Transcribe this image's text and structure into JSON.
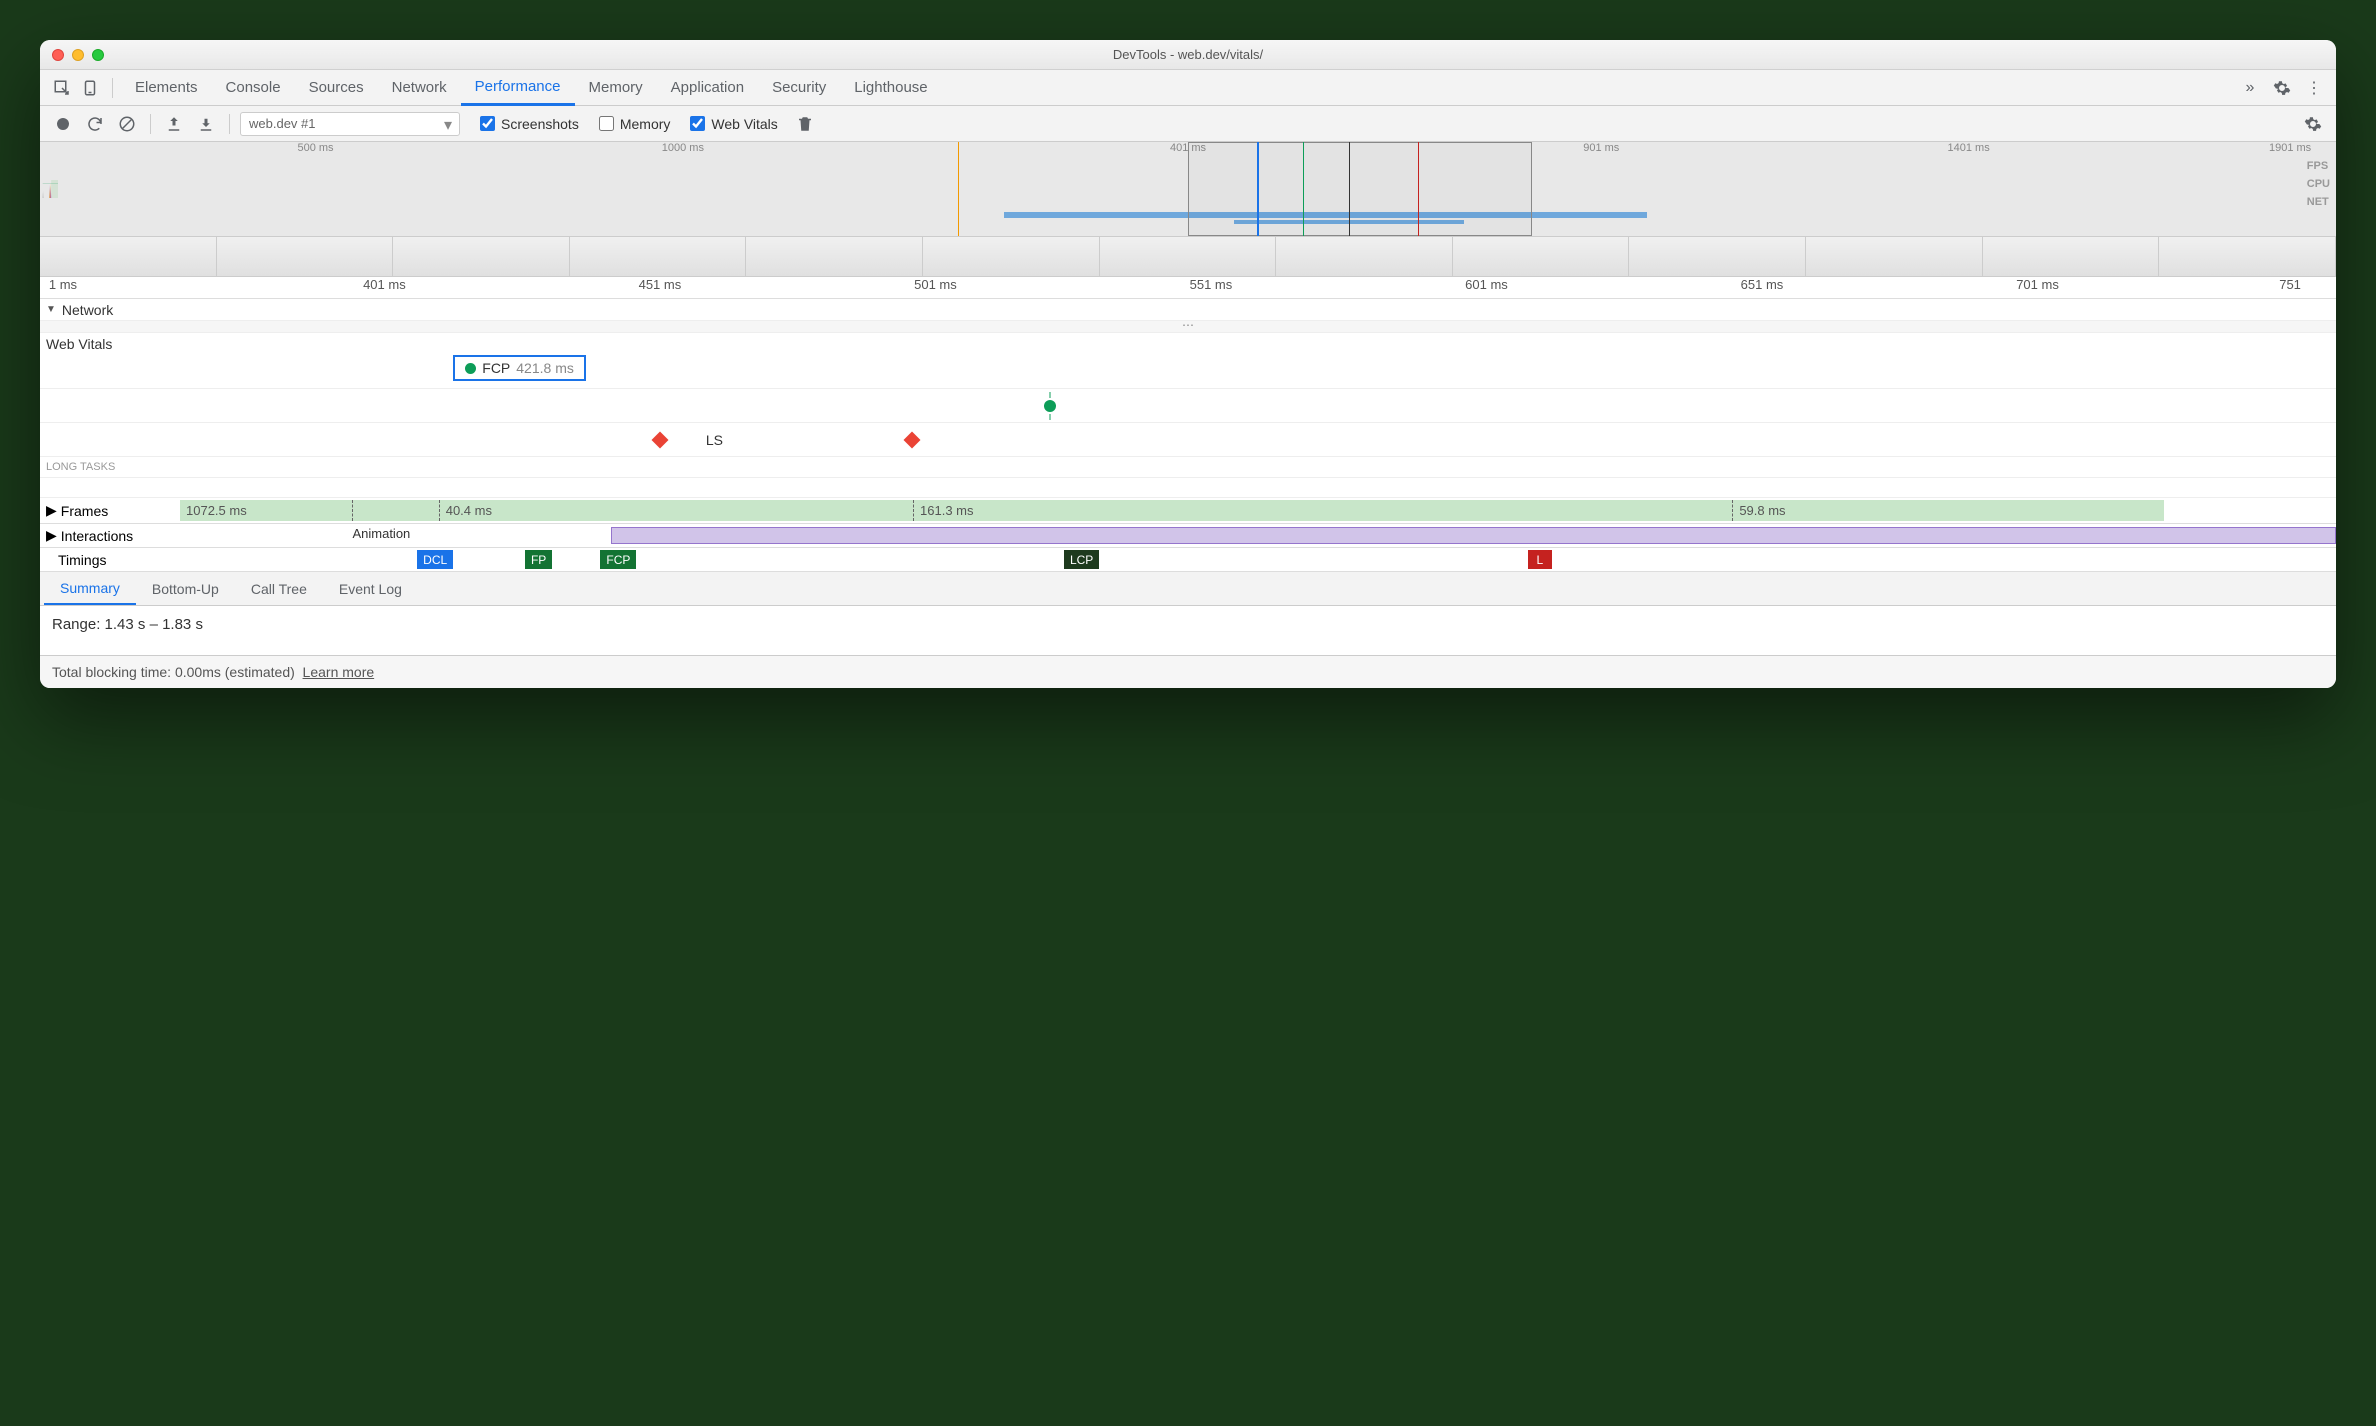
{
  "window": {
    "title": "DevTools - web.dev/vitals/"
  },
  "tabs": [
    "Elements",
    "Console",
    "Sources",
    "Network",
    "Performance",
    "Memory",
    "Application",
    "Security",
    "Lighthouse"
  ],
  "active_tab": "Performance",
  "toolbar": {
    "recording_select": "web.dev #1",
    "screenshots_label": "Screenshots",
    "screenshots_checked": true,
    "memory_label": "Memory",
    "memory_checked": false,
    "webvitals_label": "Web Vitals",
    "webvitals_checked": true
  },
  "overview": {
    "ticks": [
      "500 ms",
      "1000 ms",
      "401 ms",
      "901 ms",
      "1401 ms",
      "1901 ms"
    ],
    "labels": [
      "FPS",
      "CPU",
      "NET"
    ]
  },
  "timeticks": [
    "1 ms",
    "401 ms",
    "451 ms",
    "501 ms",
    "551 ms",
    "601 ms",
    "651 ms",
    "701 ms",
    "751"
  ],
  "network_header": "Network",
  "webvitals": {
    "header": "Web Vitals",
    "fcp": {
      "label": "FCP",
      "value": "421.8 ms"
    },
    "ls_label": "LS",
    "long_tasks_label": "LONG TASKS"
  },
  "frames": {
    "header": "Frames",
    "segments": [
      "1072.5 ms",
      "40.4 ms",
      "161.3 ms",
      "59.8 ms"
    ]
  },
  "interactions": {
    "header": "Interactions",
    "animation_label": "Animation"
  },
  "timings": {
    "header": "Timings",
    "badges": [
      {
        "label": "DCL",
        "color": "#1a73e8"
      },
      {
        "label": "FP",
        "color": "#137333"
      },
      {
        "label": "FCP",
        "color": "#137333"
      },
      {
        "label": "LCP",
        "color": "#1e3a1e"
      },
      {
        "label": "L",
        "color": "#c5221f"
      }
    ]
  },
  "details_tabs": [
    "Summary",
    "Bottom-Up",
    "Call Tree",
    "Event Log"
  ],
  "active_details_tab": "Summary",
  "summary": {
    "range": "Range: 1.43 s – 1.83 s"
  },
  "footer": {
    "tbt": "Total blocking time: 0.00ms (estimated)",
    "learn_more": "Learn more"
  }
}
